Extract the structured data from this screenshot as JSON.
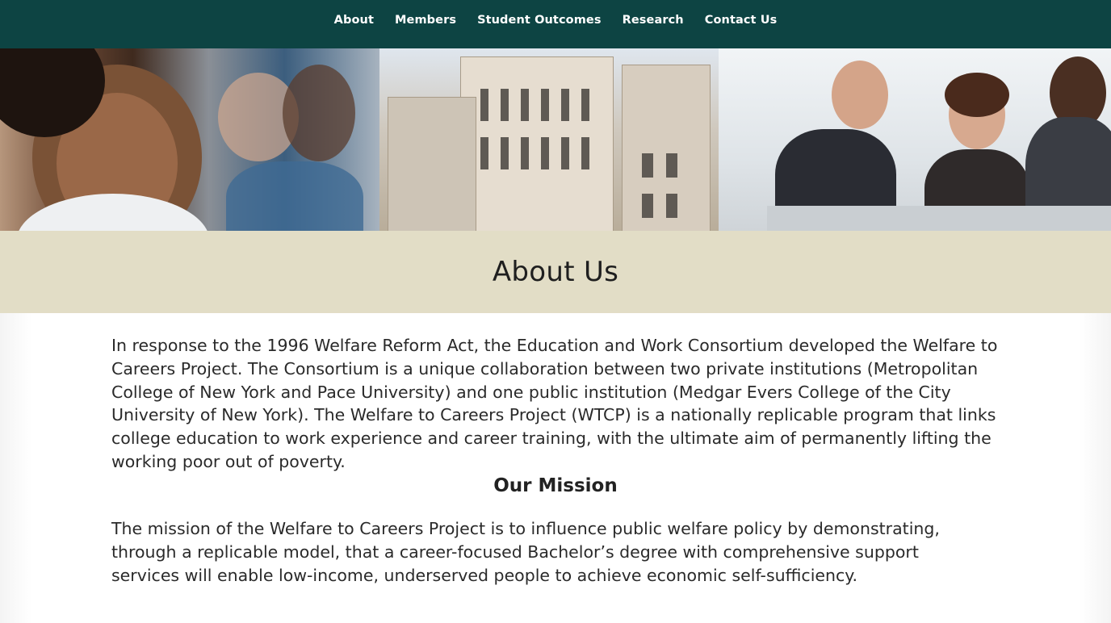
{
  "nav": {
    "items": [
      "About",
      "Members",
      "Student Outcomes",
      "Research",
      "Contact Us"
    ]
  },
  "banner": {
    "image": "banner-photo-collage"
  },
  "page": {
    "title": "About Us",
    "intro": "In response to the 1996 Welfare Reform Act, the Education and Work Consortium developed the Welfare to Careers Project. The Consortium is a unique collaboration between two private institutions (Metropolitan College of New York and Pace University) and one public institution (Medgar Evers College of the City University of New York). The Welfare to Careers Project (WTCP) is a nationally replicable program that links college education to work experience and career training, with the ultimate aim of permanently lifting the working poor out of poverty.",
    "mission_heading": "Our Mission",
    "mission_text": "The mission of the Welfare to Careers Project is to influence public welfare policy by demonstrating, through a replicable model, that a career-focused Bachelor’s degree with comprehensive support services will enable low-income, underserved people to achieve economic self-sufficiency."
  },
  "colors": {
    "nav_bg": "#0d4443",
    "title_band_bg": "#e2ddc6"
  }
}
